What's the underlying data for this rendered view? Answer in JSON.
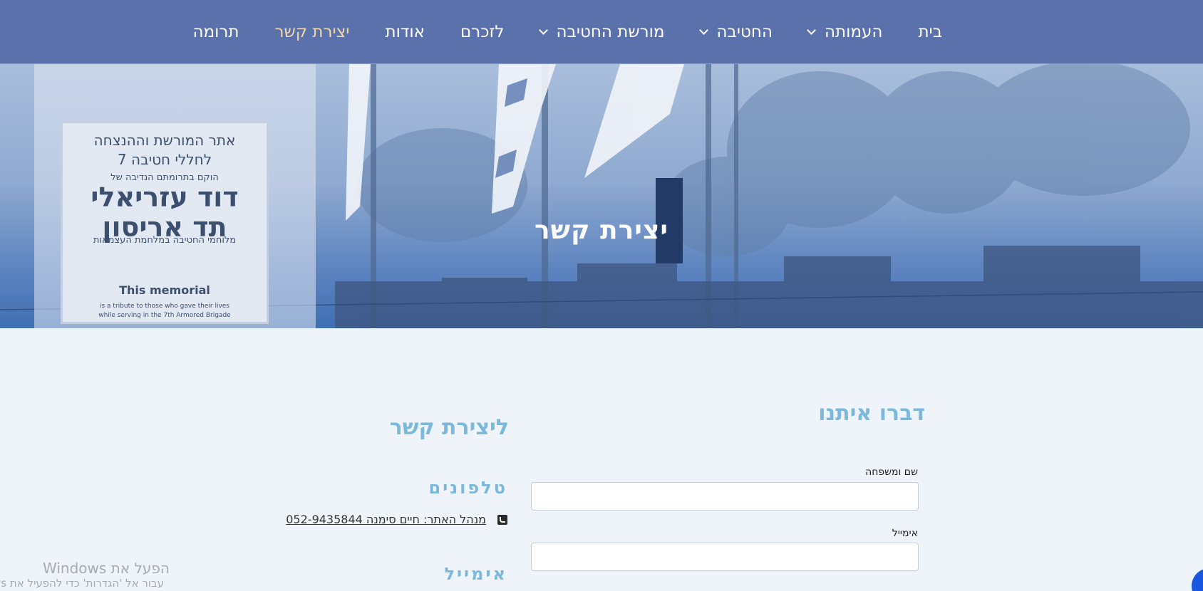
{
  "nav": {
    "items": [
      {
        "label": "בית",
        "dropdown": false,
        "active": false
      },
      {
        "label": "העמותה",
        "dropdown": true,
        "active": false
      },
      {
        "label": "החטיבה",
        "dropdown": true,
        "active": false
      },
      {
        "label": "מורשת החטיבה",
        "dropdown": true,
        "active": false
      },
      {
        "label": "לזכרם",
        "dropdown": false,
        "active": false
      },
      {
        "label": "אודות",
        "dropdown": false,
        "active": false
      },
      {
        "label": "יצירת קשר",
        "dropdown": false,
        "active": true
      },
      {
        "label": "תרומה",
        "dropdown": false,
        "active": false
      }
    ]
  },
  "hero": {
    "title": "יצירת קשר",
    "sign": {
      "line1": "אתר המורשת וההנצחה",
      "line2": "לחללי חטיבה 7",
      "line3": "הוקם בתרומתם הנדיבה של",
      "line4": "דוד עזריאלי",
      "line5": "תד אריסון",
      "line6": "מלוחמי החטיבה במלחמת העצמאות",
      "en_title": "This memorial",
      "en_line1": "is a tribute to those who gave their lives",
      "en_line2": "while serving in the 7th Armored Brigade"
    }
  },
  "form": {
    "heading": "דברו איתנו",
    "name_label": "שם ומשפחה",
    "name_value": "",
    "email_label": "אימייל",
    "email_value": ""
  },
  "contact": {
    "heading": "ליצירת קשר",
    "phones_heading": "טלפונים",
    "phone_text": "מנהל האתר: חיים סימנה 052-9435844",
    "email_heading": "אימייל"
  },
  "watermark": {
    "line1": "הפעל את Windows",
    "line2": "עבור אל 'הגדרות' כדי להפעיל את Windows"
  },
  "colors": {
    "nav_bg": "#5a71ac",
    "nav_active": "#f2d8a6",
    "heading": "#7cb8dc",
    "page_bg": "#eef4f9"
  }
}
